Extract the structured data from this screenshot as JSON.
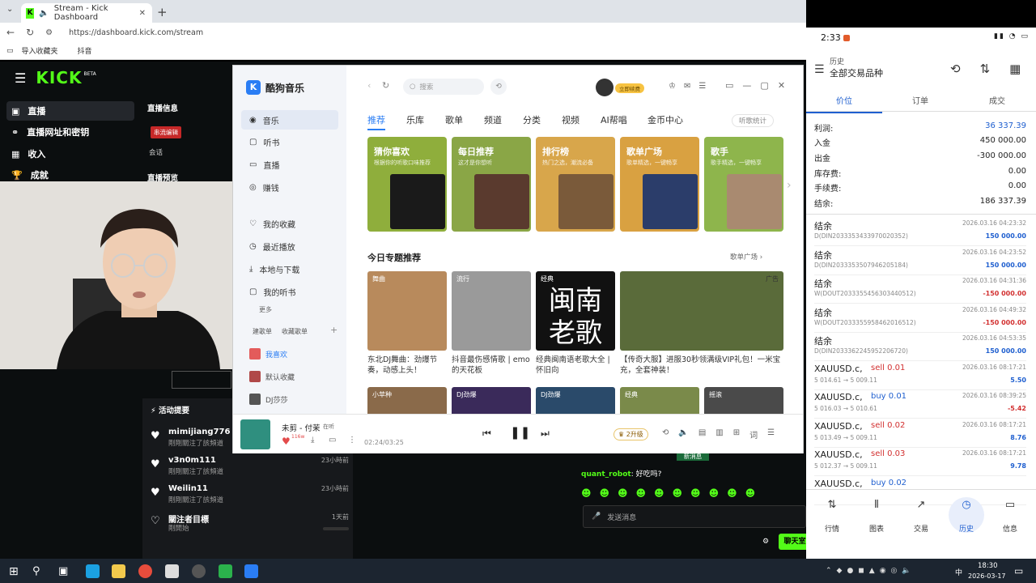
{
  "browser": {
    "tab_title": "Stream - Kick Dashboard",
    "url": "https://dashboard.kick.com/stream",
    "bookmarks": [
      "导入收藏夹",
      "抖音"
    ]
  },
  "kick": {
    "logo": "KICK",
    "logo_beta": "BETA",
    "nav": [
      "直播",
      "直播网址和密钥",
      "收入",
      "成就"
    ],
    "panel_title": "直播信息",
    "panel_badge": "串流编辑",
    "panel_sub": "会话",
    "panel_title2": "直播预览",
    "activity": {
      "title": "活动提要",
      "items": [
        {
          "name": "mimijiang776",
          "sub": "剛剛關注了該頻道",
          "time": "",
          "icon": "heart-icon"
        },
        {
          "name": "v3n0m111",
          "sub": "剛剛關注了該頻道",
          "time": "23小時前",
          "icon": "heart-icon"
        },
        {
          "name": "Weilin11",
          "sub": "剛剛關注了該頻道",
          "time": "23小時前",
          "icon": "heart-icon"
        },
        {
          "name": "關注者目標",
          "sub": "剛開始",
          "time": "1天前",
          "icon": "heart-outline-icon"
        }
      ]
    },
    "chat": {
      "new_messages": "新消息",
      "message_user": "quant_robot",
      "message_text": "好吃吗?",
      "input_placeholder": "发送消息",
      "chat_button": "聊天室"
    }
  },
  "music": {
    "app_name": "酷狗音乐",
    "search_placeholder": "搜索",
    "vip_label": "立即续费",
    "sidebar_top": [
      "音乐",
      "听书",
      "直播",
      "赚钱"
    ],
    "sidebar_mid": [
      "我的收藏",
      "最近播放",
      "本地与下载",
      "我的听书"
    ],
    "more": "更多",
    "playlist_tabs": [
      "建歌单",
      "收藏歌单"
    ],
    "playlists": [
      "我喜欢",
      "默认收藏",
      "DJ莎莎"
    ],
    "tabs": [
      "推荐",
      "乐库",
      "歌单",
      "频道",
      "分类",
      "视频",
      "AI帮唱",
      "金币中心"
    ],
    "listen_stats": "听歌统计",
    "cards": [
      {
        "title": "猜你喜欢",
        "sub": "根据你的听歌口味推荐",
        "color": "#8fae3c"
      },
      {
        "title": "每日推荐",
        "sub": "这才是你想听",
        "color": "#8aa646"
      },
      {
        "title": "排行榜",
        "sub": "热门之选，潮流必备",
        "color": "#d8a64b"
      },
      {
        "title": "歌单广场",
        "sub": "歌单精选，一键畅享",
        "color": "#d9a141"
      },
      {
        "title": "歌手",
        "sub": "歌手精选，一键畅享",
        "color": "#8eb54c"
      }
    ],
    "section_title": "今日专题推荐",
    "section_more": "歌单广场",
    "topics": [
      {
        "tag": "舞曲",
        "caption": "东北DJ舞曲：劲爆节奏，动感上头！"
      },
      {
        "tag": "流行",
        "caption": "抖音最伤感情歌 | emo的天花板"
      },
      {
        "tag": "经典",
        "caption": "经典闽南语老歌大全 | 怀旧向",
        "big": "闽南老歌"
      },
      {
        "tag": "广告",
        "caption": "【传奇大服】进服30秒领满级VIP礼包！一米宝充，全套神装！"
      }
    ],
    "row3": [
      "小苹种",
      "DJ劲爆",
      "DJ劲爆",
      "经典",
      "摇滚"
    ],
    "player": {
      "song": "未剪 - 付茉",
      "badge": "在听",
      "like_count": "116w",
      "time": "02:24/03:25",
      "upgrade": "2升级"
    }
  },
  "phone": {
    "time": "2:33",
    "title": "历史",
    "subtitle": "全部交易品种",
    "tabs": [
      "价位",
      "订单",
      "成交"
    ],
    "summary": [
      {
        "label": "利润:",
        "value": "36 337.39",
        "color": "#1f5fcf"
      },
      {
        "label": "入金",
        "value": "450 000.00",
        "color": "#222"
      },
      {
        "label": "出金",
        "value": "-300 000.00",
        "color": "#222"
      },
      {
        "label": "库存费:",
        "value": "0.00",
        "color": "#222"
      },
      {
        "label": "手续费:",
        "value": "0.00",
        "color": "#222"
      },
      {
        "label": "结余:",
        "value": "186 337.39",
        "color": "#222"
      }
    ],
    "trades": [
      {
        "a": "结余",
        "a2": "",
        "b": "D(DIN2033353433970020352)",
        "c": "2026.03.16 04:23:32",
        "d": "150 000.00",
        "dc": "#1f5fcf"
      },
      {
        "a": "结余",
        "a2": "",
        "b": "D(DIN2033353507946205184)",
        "c": "2026.03.16 04:23:52",
        "d": "150 000.00",
        "dc": "#1f5fcf"
      },
      {
        "a": "结余",
        "a2": "",
        "b": "W(DOUT2033355456303440512)",
        "c": "2026.03.16 04:31:36",
        "d": "-150 000.00",
        "dc": "#d23030"
      },
      {
        "a": "结余",
        "a2": "",
        "b": "W(DOUT2033355958462016512)",
        "c": "2026.03.16 04:49:32",
        "d": "-150 000.00",
        "dc": "#d23030"
      },
      {
        "a": "结余",
        "a2": "",
        "b": "D(DIN2033362245952206720)",
        "c": "2026.03.16 04:53:35",
        "d": "150 000.00",
        "dc": "#1f5fcf"
      },
      {
        "a": "XAUUSD.c,",
        "a2": "sell 0.01",
        "b": "5 014.61 → 5 009.11",
        "c": "2026.03.16 08:17:21",
        "d": "5.50",
        "dc": "#1f5fcf"
      },
      {
        "a": "XAUUSD.c,",
        "a2": "buy 0.01",
        "b": "5 016.03 → 5 010.61",
        "c": "2026.03.16 08:39:25",
        "d": "-5.42",
        "dc": "#d23030"
      },
      {
        "a": "XAUUSD.c,",
        "a2": "sell 0.02",
        "b": "5 013.49 → 5 009.11",
        "c": "2026.03.16 08:17:21",
        "d": "8.76",
        "dc": "#1f5fcf"
      },
      {
        "a": "XAUUSD.c,",
        "a2": "sell 0.03",
        "b": "5 012.37 → 5 009.11",
        "c": "2026.03.16 08:17:21",
        "d": "9.78",
        "dc": "#1f5fcf"
      },
      {
        "a": "XAUUSD.c,",
        "a2": "buy 0.02",
        "b": "",
        "c": "",
        "d": "",
        "dc": "#1f5fcf"
      }
    ],
    "bottom_nav": [
      "行情",
      "图表",
      "交易",
      "历史",
      "信息"
    ]
  },
  "taskbar": {
    "time": "18:30",
    "date": "2026-03-17",
    "lang": "中"
  }
}
